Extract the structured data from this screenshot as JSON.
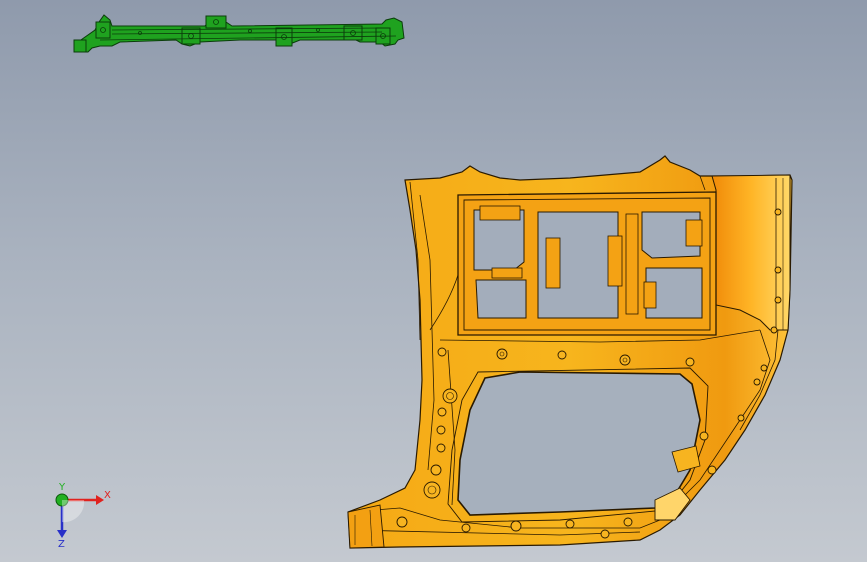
{
  "viewport": {
    "background_top": "#8f9aac",
    "background_bottom": "#c4c9d0"
  },
  "models": {
    "rail_part": {
      "color": "#1fa21f",
      "edge_color": "#0b3d0b"
    },
    "side_panel": {
      "color": "#f0a313",
      "highlight_color": "#ffd24a",
      "edge_color": "#2a1a00"
    }
  },
  "triad": {
    "x_label": "X",
    "y_label": "Y",
    "z_label": "Z",
    "x_color": "#e0221e",
    "y_color": "#22b022",
    "z_color": "#2830c8"
  }
}
